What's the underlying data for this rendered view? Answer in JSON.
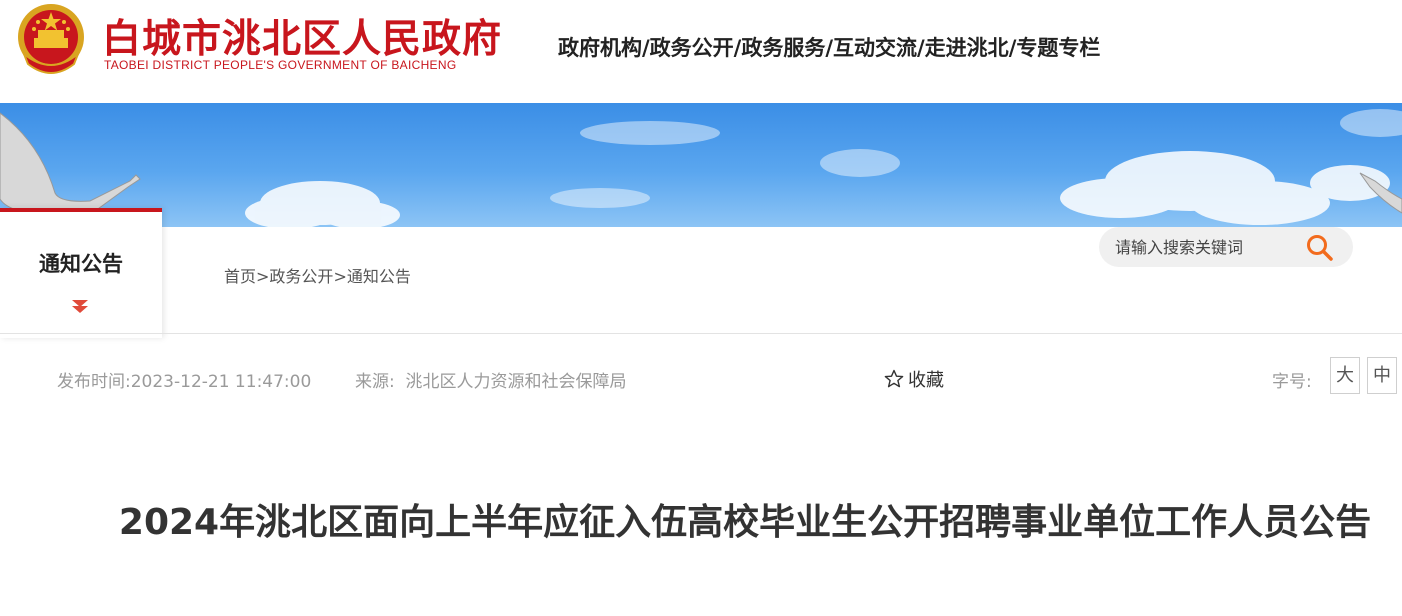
{
  "header": {
    "site_name_cn": "白城市洮北区人民政府",
    "site_name_en": "TAOBEI DISTRICT PEOPLE'S GOVERNMENT OF BAICHENG",
    "nav": [
      "政府机构",
      "政务公开",
      "政务服务",
      "互动交流",
      "走进洮北",
      "专题专栏"
    ],
    "nav_separator": "/",
    "emblem_icon": "national-emblem-icon"
  },
  "channel": {
    "title": "通知公告"
  },
  "breadcrumb": {
    "items": [
      "首页",
      "政务公开",
      "通知公告"
    ],
    "separator": ">"
  },
  "search": {
    "placeholder": "请输入搜索关键词",
    "icon": "search-icon"
  },
  "meta": {
    "publish_label": "发布时间:",
    "publish_time": "2023-12-21 11:47:00",
    "source_label": "来源:",
    "source": "洮北区人力资源和社会保障局",
    "favorite_label": "收藏",
    "favorite_icon": "star-outline-icon",
    "font_size_label": "字号:",
    "font_size_large": "大",
    "font_size_medium": "中"
  },
  "article": {
    "title": "2024年洮北区面向上半年应征入伍高校毕业生公开招聘事业单位工作人员公告"
  },
  "colors": {
    "brand_red": "#c8161d",
    "search_accent": "#f26b1d",
    "banner_sky": "#4a9be9"
  }
}
